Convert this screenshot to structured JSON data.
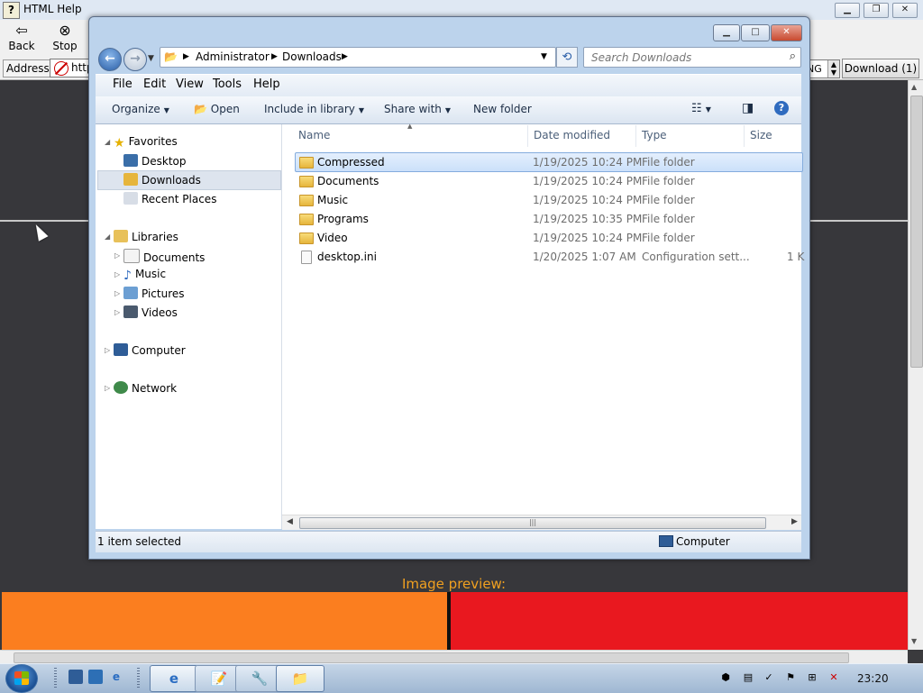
{
  "background_window": {
    "title": "HTML Help",
    "toolbar": {
      "back_label": "Back",
      "stop_label": "Stop"
    },
    "address_label": "Address",
    "address_value": "http",
    "ng_value": "NG",
    "download_label": "Download (1)",
    "image_preview_label": "Image preview:",
    "preview_colors": {
      "left": "#fb7e1f",
      "right": "#e9181f"
    }
  },
  "explorer": {
    "breadcrumb": [
      "Administrator",
      "Downloads"
    ],
    "search_placeholder": "Search Downloads",
    "menu": [
      "File",
      "Edit",
      "View",
      "Tools",
      "Help"
    ],
    "commands": {
      "organize": "Organize",
      "open": "Open",
      "include_in_library": "Include in library",
      "share_with": "Share with",
      "new_folder": "New folder"
    },
    "nav": {
      "favorites": "Favorites",
      "favorites_items": [
        "Desktop",
        "Downloads",
        "Recent Places"
      ],
      "libraries": "Libraries",
      "libraries_items": [
        "Documents",
        "Music",
        "Pictures",
        "Videos"
      ],
      "computer": "Computer",
      "network": "Network"
    },
    "columns": {
      "name": "Name",
      "date": "Date modified",
      "type": "Type",
      "size": "Size"
    },
    "files": [
      {
        "name": "Compressed",
        "date": "1/19/2025 10:24 PM",
        "type": "File folder",
        "size": ""
      },
      {
        "name": "Documents",
        "date": "1/19/2025 10:24 PM",
        "type": "File folder",
        "size": ""
      },
      {
        "name": "Music",
        "date": "1/19/2025 10:24 PM",
        "type": "File folder",
        "size": ""
      },
      {
        "name": "Programs",
        "date": "1/19/2025 10:35 PM",
        "type": "File folder",
        "size": ""
      },
      {
        "name": "Video",
        "date": "1/19/2025 10:24 PM",
        "type": "File folder",
        "size": ""
      },
      {
        "name": "desktop.ini",
        "date": "1/20/2025 1:07 AM",
        "type": "Configuration sett...",
        "size": "1 K"
      }
    ],
    "status": {
      "selection": "1 item selected",
      "location": "Computer"
    }
  },
  "taskbar": {
    "clock": "23:20"
  }
}
